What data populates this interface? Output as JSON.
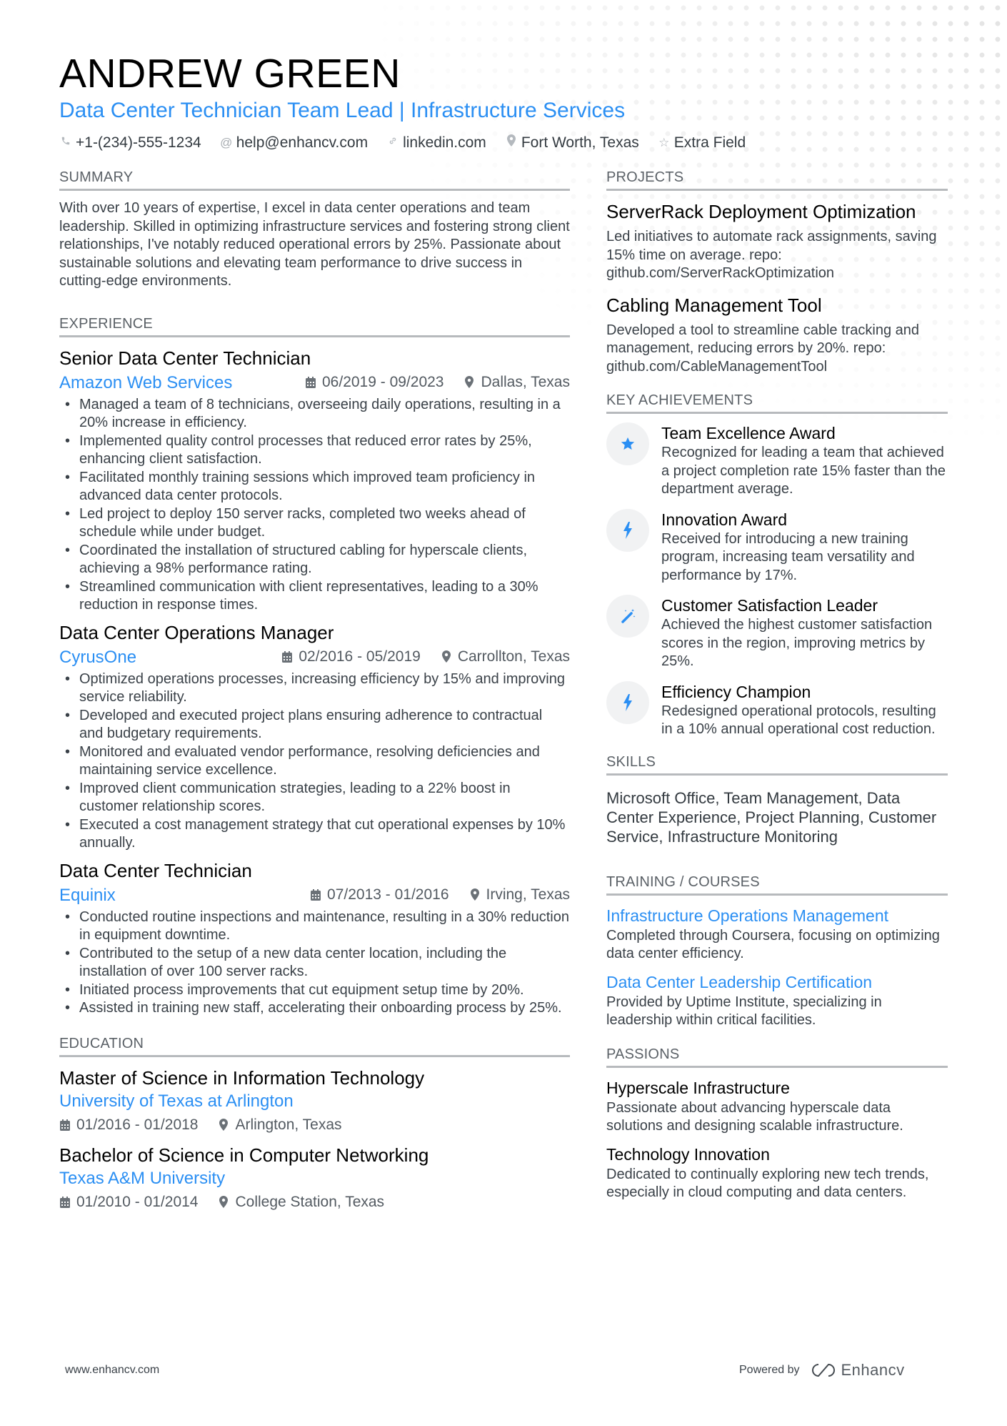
{
  "header": {
    "name": "ANDREW GREEN",
    "title": "Data Center Technician Team Lead | Infrastructure Services",
    "contacts": [
      {
        "icon": "phone-icon",
        "text": "+1-(234)-555-1234"
      },
      {
        "icon": "at-icon",
        "text": "help@enhancv.com"
      },
      {
        "icon": "link-icon",
        "text": "linkedin.com"
      },
      {
        "icon": "location-pin-icon",
        "text": "Fort Worth, Texas"
      },
      {
        "icon": "star-outline-icon",
        "text": "Extra Field"
      }
    ]
  },
  "colors": {
    "accent": "#2b8ff3",
    "heading": "#000000",
    "body": "#3a4148",
    "rule": "#b7babd"
  },
  "summary": {
    "heading": "SUMMARY",
    "text": "With over 10 years of expertise, I excel in data center operations and team leadership. Skilled in optimizing infrastructure services and fostering strong client relationships, I've notably reduced operational errors by 25%. Passionate about sustainable solutions and elevating team performance to drive success in cutting-edge environments."
  },
  "experience": {
    "heading": "EXPERIENCE",
    "jobs": [
      {
        "title": "Senior Data Center Technician",
        "company": "Amazon Web Services",
        "dates": "06/2019 - 09/2023",
        "location": "Dallas, Texas",
        "bullets": [
          "Managed a team of 8 technicians, overseeing daily operations, resulting in a 20% increase in efficiency.",
          "Implemented quality control processes that reduced error rates by 25%, enhancing client satisfaction.",
          "Facilitated monthly training sessions which improved team proficiency in advanced data center protocols.",
          "Led project to deploy 150 server racks, completed two weeks ahead of schedule while under budget.",
          "Coordinated the installation of structured cabling for hyperscale clients, achieving a 98% performance rating.",
          "Streamlined communication with client representatives, leading to a 30% reduction in response times."
        ]
      },
      {
        "title": "Data Center Operations Manager",
        "company": "CyrusOne",
        "dates": "02/2016 - 05/2019",
        "location": "Carrollton, Texas",
        "bullets": [
          "Optimized operations processes, increasing efficiency by 15% and improving service reliability.",
          "Developed and executed project plans ensuring adherence to contractual and budgetary requirements.",
          "Monitored and evaluated vendor performance, resolving deficiencies and maintaining service excellence.",
          "Improved client communication strategies, leading to a 22% boost in customer relationship scores.",
          "Executed a cost management strategy that cut operational expenses by 10% annually."
        ]
      },
      {
        "title": "Data Center Technician",
        "company": "Equinix",
        "dates": "07/2013 - 01/2016",
        "location": "Irving, Texas",
        "bullets": [
          "Conducted routine inspections and maintenance, resulting in a 30% reduction in equipment downtime.",
          "Contributed to the setup of a new data center location, including the installation of over 100 server racks.",
          "Initiated process improvements that cut equipment setup time by 20%.",
          "Assisted in training new staff, accelerating their onboarding process by 25%."
        ]
      }
    ]
  },
  "education": {
    "heading": "EDUCATION",
    "items": [
      {
        "degree": "Master of Science in Information Technology",
        "school": "University of Texas at Arlington",
        "dates": "01/2016 - 01/2018",
        "location": "Arlington, Texas"
      },
      {
        "degree": "Bachelor of Science in Computer Networking",
        "school": "Texas A&M University",
        "dates": "01/2010 - 01/2014",
        "location": "College Station, Texas"
      }
    ]
  },
  "projects": {
    "heading": "PROJECTS",
    "items": [
      {
        "title": "ServerRack Deployment Optimization",
        "desc": "Led initiatives to automate rack assignments, saving 15% time on average. repo: github.com/ServerRackOptimization"
      },
      {
        "title": "Cabling Management Tool",
        "desc": "Developed a tool to streamline cable tracking and management, reducing errors by 20%. repo: github.com/CableManagementTool"
      }
    ]
  },
  "achievements": {
    "heading": "KEY ACHIEVEMENTS",
    "items": [
      {
        "icon": "star-icon",
        "title": "Team Excellence Award",
        "desc": "Recognized for leading a team that achieved a project completion rate 15% faster than the department average."
      },
      {
        "icon": "lightning-icon",
        "title": "Innovation Award",
        "desc": "Received for introducing a new training program, increasing team versatility and performance by 17%."
      },
      {
        "icon": "magic-wand-icon",
        "title": "Customer Satisfaction Leader",
        "desc": "Achieved the highest customer satisfaction scores in the region, improving metrics by 25%."
      },
      {
        "icon": "lightning-icon",
        "title": "Efficiency Champion",
        "desc": "Redesigned operational protocols, resulting in a 10% annual operational cost reduction."
      }
    ]
  },
  "skills": {
    "heading": "SKILLS",
    "text": "Microsoft Office, Team Management, Data Center Experience, Project Planning, Customer Service, Infrastructure Monitoring"
  },
  "training": {
    "heading": "TRAINING / COURSES",
    "items": [
      {
        "title": "Infrastructure Operations Management",
        "desc": "Completed through Coursera, focusing on optimizing data center efficiency."
      },
      {
        "title": "Data Center Leadership Certification",
        "desc": "Provided by Uptime Institute, specializing in leadership within critical facilities."
      }
    ]
  },
  "passions": {
    "heading": "PASSIONS",
    "items": [
      {
        "title": "Hyperscale Infrastructure",
        "desc": "Passionate about advancing hyperscale data solutions and designing scalable infrastructure."
      },
      {
        "title": "Technology Innovation",
        "desc": "Dedicated to continually exploring new tech trends, especially in cloud computing and data centers."
      }
    ]
  },
  "footer": {
    "website": "www.enhancv.com",
    "powered_by": "Powered by",
    "brand": "Enhancv"
  }
}
